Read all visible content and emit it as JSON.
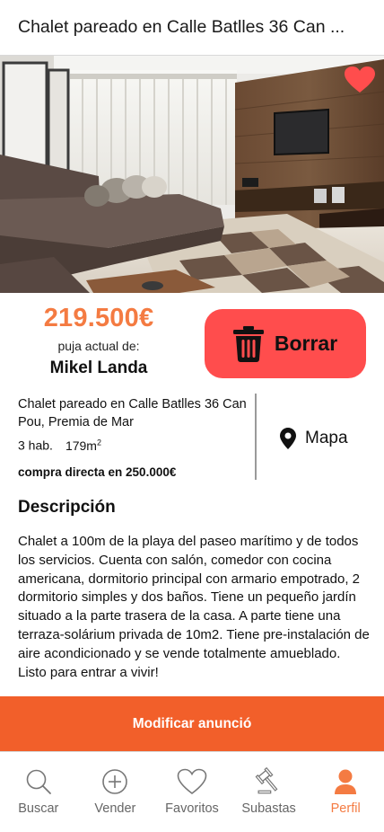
{
  "header": {
    "title": "Chalet pareado en Calle Batlles 36 Can ..."
  },
  "listing": {
    "price": "219.500€",
    "bid_label": "puja actual de:",
    "bidder": "Mikel Landa",
    "address": "Chalet pareado en Calle Batlles 36 Can Pou, Premia de Mar",
    "rooms": "3 hab.",
    "area": "179m",
    "area_unit_sup": "2",
    "direct_buy": "compra directa en 250.000€"
  },
  "actions": {
    "delete_label": "Borrar",
    "map_label": "Mapa",
    "modify_label": "Modificar anunció"
  },
  "description": {
    "title": "Descripción",
    "text": "Chalet a 100m de la playa del paseo marítimo y de todos los servicios. Cuenta con salón, comedor con cocina americana, dormitorio principal con armario empotrado, 2 dormitorio simples y dos baños. Tiene un pequeño jardín situado a la parte trasera de la casa. A parte tiene una terraza-solárium privada de 10m2. Tiene pre-instalación de aire acondicionado y se vende totalmente amueblado. Listo para entrar a vivir!"
  },
  "tabs": [
    {
      "label": "Buscar",
      "icon": "search-icon"
    },
    {
      "label": "Vender",
      "icon": "plus-circle-icon"
    },
    {
      "label": "Favoritos",
      "icon": "heart-outline-icon"
    },
    {
      "label": "Subastas",
      "icon": "gavel-icon"
    },
    {
      "label": "Perfil",
      "icon": "user-icon",
      "active": true
    }
  ],
  "colors": {
    "accent": "#f47b42",
    "delete_button": "#ff4d4d",
    "modify_bar": "#f25f2a",
    "favorite_heart": "#ff4d4d"
  }
}
